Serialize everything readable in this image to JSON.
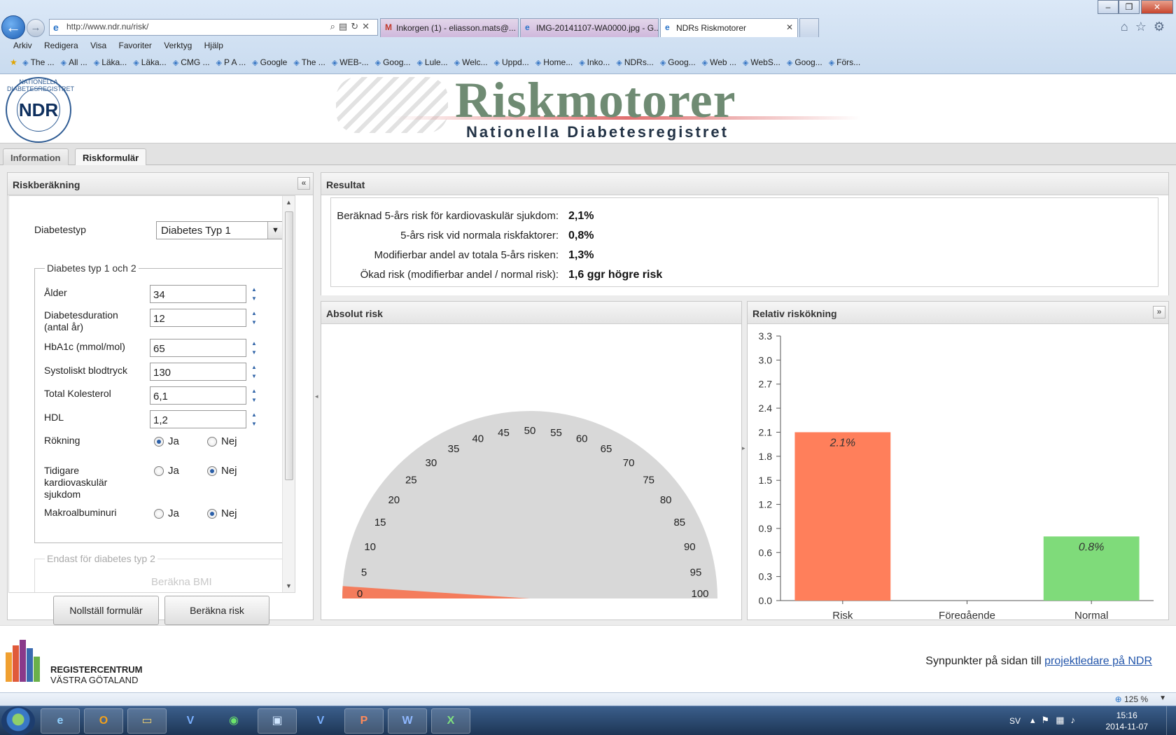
{
  "browser": {
    "window_buttons": [
      "–",
      "❐",
      "✕"
    ],
    "address": "http://www.ndr.nu/risk/",
    "tabs": [
      {
        "label": "Inkorgen (1) - eliasson.mats@...",
        "icon": "M"
      },
      {
        "label": "IMG-20141107-WA0000.jpg - G...",
        "icon": "e"
      },
      {
        "label": "NDRs Riskmotorer",
        "icon": "e",
        "active": true
      }
    ],
    "menu": [
      "Arkiv",
      "Redigera",
      "Visa",
      "Favoriter",
      "Verktyg",
      "Hjälp"
    ],
    "favorites": [
      "The ...",
      "All ...",
      "Läka...",
      "Läka...",
      "CMG ...",
      "P A ...",
      "Google",
      "The ...",
      "WEB-...",
      "Goog...",
      "Lule...",
      "Welc...",
      "Uppd...",
      "Home...",
      "Inko...",
      "NDRs...",
      "Goog...",
      "Web ...",
      "WebS...",
      "Goog...",
      "Förs..."
    ],
    "zoom": "125 %"
  },
  "header": {
    "logo_text": "NDR",
    "logo_ring": "NATIONELLA DIABETESREGISTRET",
    "title": "Riskmotorer",
    "subtitle": "Nationella Diabetesregistret"
  },
  "tabs": [
    "Information",
    "Riskformulär"
  ],
  "form": {
    "title": "Riskberäkning",
    "collapse_icon": "«",
    "diabetestyp_label": "Diabetestyp",
    "diabetestyp_value": "Diabetes Typ 1",
    "group1_legend": "Diabetes typ 1 och 2",
    "alder_label": "Ålder",
    "alder_value": "34",
    "duration_label1": "Diabetesduration",
    "duration_label2": "(antal år)",
    "duration_value": "12",
    "hba1c_label": "HbA1c (mmol/mol)",
    "hba1c_value": "65",
    "systoliskt_label": "Systoliskt blodtryck",
    "systoliskt_value": "130",
    "kolesterol_label": "Total Kolesterol",
    "kolesterol_value": "6,1",
    "hdl_label": "HDL",
    "hdl_value": "1,2",
    "rokning_label": "Rökning",
    "tidigare_label1": "Tidigare",
    "tidigare_label2": "kardiovaskulär",
    "tidigare_label3": "sjukdom",
    "makro_label": "Makroalbuminuri",
    "ja": "Ja",
    "nej": "Nej",
    "group2_legend": "Endast för diabetes typ 2",
    "group2_faded": "Beräkna BMI",
    "reset_button": "Nollställ formulär",
    "calc_button": "Beräkna risk"
  },
  "result": {
    "title": "Resultat",
    "rows": [
      {
        "label": "Beräknad 5-års risk för kardiovaskulär sjukdom:",
        "value": "2,1%"
      },
      {
        "label": "5-års risk vid normala riskfaktorer:",
        "value": "0,8%"
      },
      {
        "label": "Modifierbar andel av totala 5-års risken:",
        "value": "1,3%"
      },
      {
        "label": "Ökad risk (modifierbar andel / normal risk):",
        "value": "1,6 ggr högre risk"
      }
    ]
  },
  "absolute": {
    "title": "Absolut risk"
  },
  "relative": {
    "title": "Relativ riskökning",
    "expand_icon": "»"
  },
  "chart_data": [
    {
      "type": "gauge",
      "title": "Absolut risk",
      "min": 0,
      "max": 100,
      "ticks": [
        0,
        5,
        10,
        15,
        20,
        25,
        30,
        35,
        40,
        45,
        50,
        55,
        60,
        65,
        70,
        75,
        80,
        85,
        90,
        95,
        100
      ],
      "value": 2.1,
      "colors": {
        "dial": "#d8d8d8",
        "value": "#f47c5c"
      }
    },
    {
      "type": "bar",
      "title": "Relativ riskökning",
      "categories": [
        "Risk",
        "Föregående",
        "Normal"
      ],
      "values": [
        2.1,
        null,
        0.8
      ],
      "labels": [
        "2.1%",
        "",
        "0.8%"
      ],
      "colors": [
        "#ff7f5b",
        "#cccccc",
        "#7fdb7a"
      ],
      "ylim": [
        0,
        3.3
      ],
      "yticks": [
        "0.0",
        "0.3",
        "0.6",
        "0.9",
        "1.2",
        "1.5",
        "1.8",
        "2.1",
        "2.4",
        "2.7",
        "3.0",
        "3.3"
      ]
    }
  ],
  "footer": {
    "rc_line1": "REGISTERCENTRUM",
    "rc_line2": "VÄSTRA GÖTALAND",
    "feedback_text": "Synpunkter på sidan till ",
    "feedback_link": "projektledare på NDR"
  },
  "taskbar": {
    "lang": "SV",
    "time": "15:16",
    "date": "2014-11-07"
  }
}
